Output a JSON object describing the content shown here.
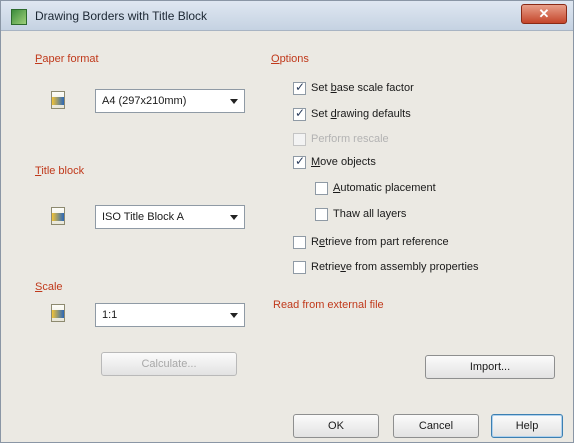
{
  "window": {
    "title": "Drawing Borders with Title Block",
    "close_label": "✕"
  },
  "paper_format": {
    "label_accel": "P",
    "label_rest": "aper format",
    "value": "A4 (297x210mm)"
  },
  "title_block": {
    "label_accel": "T",
    "label_rest": "itle block",
    "value": "ISO Title Block A"
  },
  "scale": {
    "label_accel": "S",
    "label_rest": "cale",
    "value": "1:1"
  },
  "calculate_label": "Calculate...",
  "options": {
    "label_accel": "O",
    "label_rest": "ptions",
    "items": [
      {
        "pre": "Set ",
        "accel": "b",
        "post": "ase scale factor",
        "checked": true,
        "enabled": true
      },
      {
        "pre": "Set ",
        "accel": "d",
        "post": "rawing defaults",
        "checked": true,
        "enabled": true
      },
      {
        "pre": "",
        "accel": "",
        "post": "Perform rescale",
        "checked": false,
        "enabled": false
      },
      {
        "pre": "",
        "accel": "M",
        "post": "ove objects",
        "checked": true,
        "enabled": true
      },
      {
        "pre": "",
        "accel": "A",
        "post": "utomatic placement",
        "checked": false,
        "enabled": true
      },
      {
        "pre": "",
        "accel": "",
        "post": "Thaw all layers",
        "checked": false,
        "enabled": true
      },
      {
        "pre": "R",
        "accel": "e",
        "post": "trieve from part reference",
        "checked": false,
        "enabled": true
      },
      {
        "pre": "Retrie",
        "accel": "v",
        "post": "e from assembly properties",
        "checked": false,
        "enabled": true
      }
    ]
  },
  "read_external": "Read from external file",
  "import_label": "Import...",
  "buttons": {
    "ok": "OK",
    "cancel": "Cancel",
    "help": "Help"
  }
}
